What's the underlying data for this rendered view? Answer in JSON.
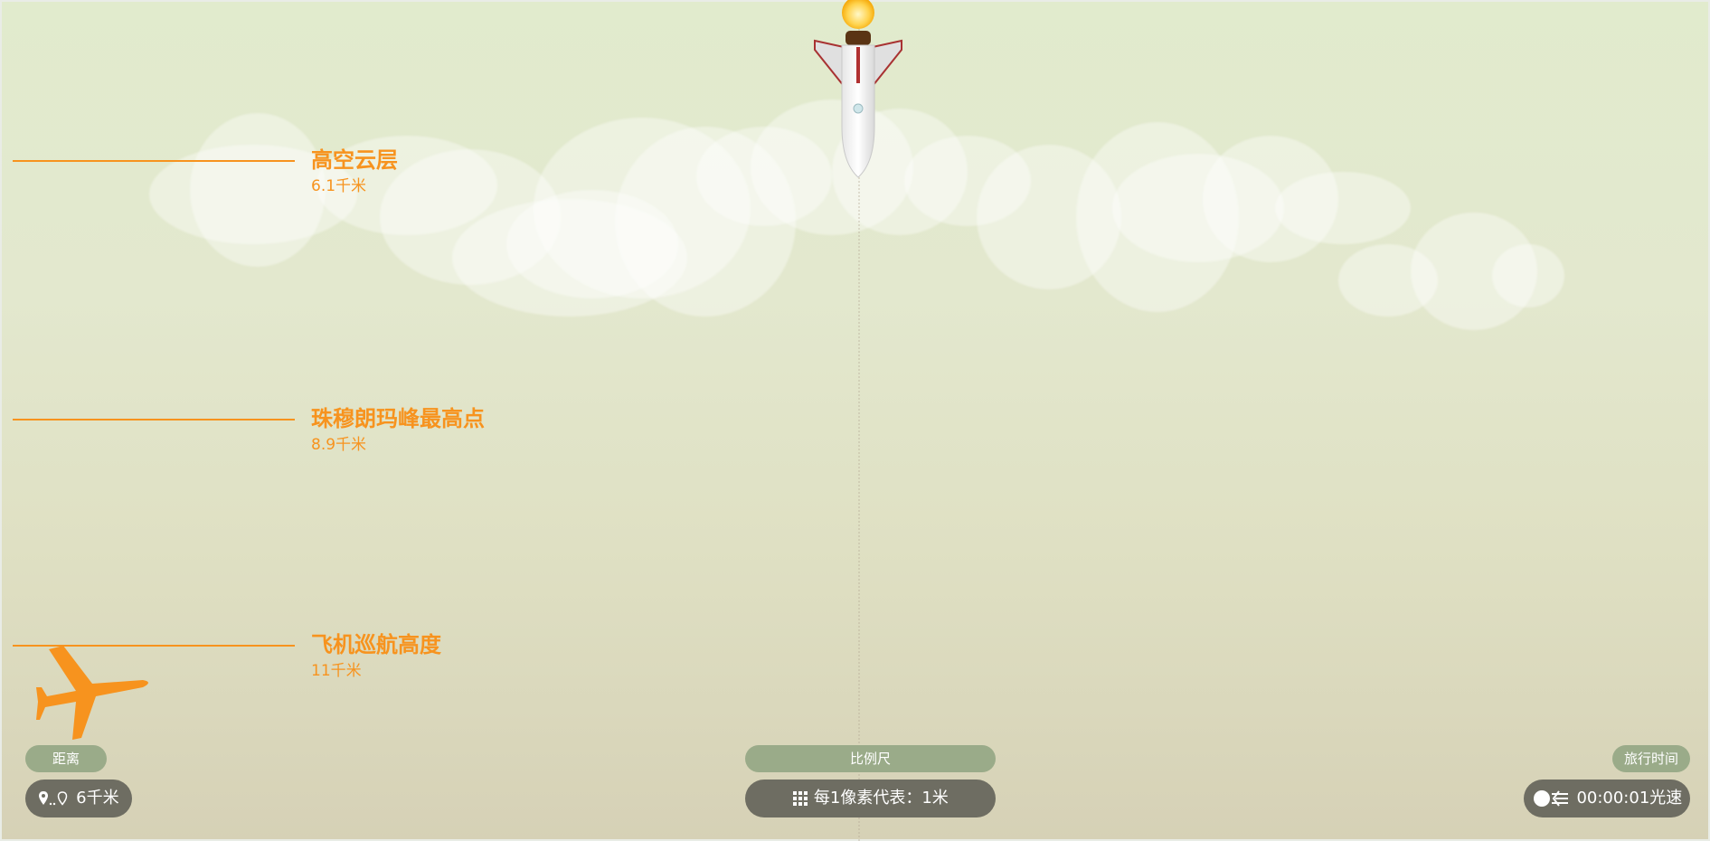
{
  "markers": [
    {
      "title": "高空云层",
      "value": "6.1千米"
    },
    {
      "title": "珠穆朗玛峰最高点",
      "value": "8.9千米"
    },
    {
      "title": "飞机巡航高度",
      "value": "11千米"
    }
  ],
  "distance": {
    "label": "距离",
    "value": "6千米",
    "icon": "location-pins-icon"
  },
  "scale": {
    "label": "比例尺",
    "value": "每1像素代表：1米",
    "icon": "grid-icon"
  },
  "travel_time": {
    "label": "旅行时间",
    "value": "00:00:01光速",
    "icon": "light-speed-icon"
  },
  "colors": {
    "accent": "#f7931e",
    "pill_label": "#9aab89",
    "pill_value": "#6e6d62"
  }
}
